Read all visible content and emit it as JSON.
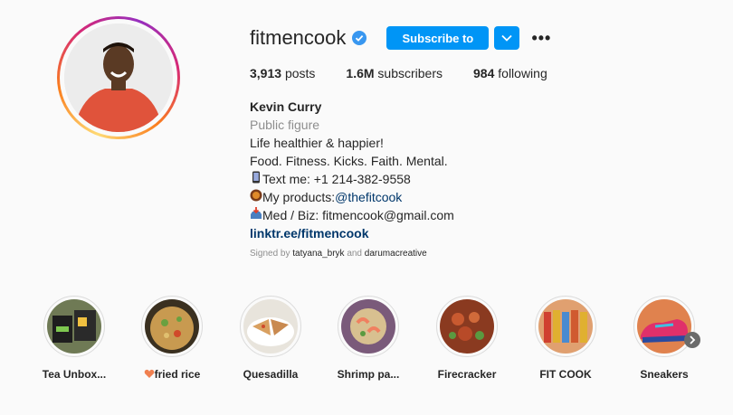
{
  "profile": {
    "username": "fitmencook",
    "subscribe_label": "Subscribe to",
    "more_label": "•••",
    "stats": [
      {
        "value": "3,913",
        "label": "posts"
      },
      {
        "value": "1.6M",
        "label": "subscribers"
      },
      {
        "value": "984",
        "label": "following"
      }
    ],
    "name": "Kevin Curry",
    "category": "Public figure",
    "bio_lines": [
      "Life healthier & happier!",
      "Food. Fitness. Kicks. Faith. Mental."
    ],
    "text_me_prefix": "Text me: +1 214-382-9558",
    "products_prefix": "My products:",
    "products_handle": "@thefitcook",
    "biz_line": "Med / Biz: fitmencook@gmail.com",
    "link": "linktr.ee/fitmencook",
    "signed_prefix": "Signed by",
    "signed_user1": "tatyana_bryk",
    "signed_and": "and",
    "signed_user2": "darumacreative"
  },
  "highlights": [
    {
      "label": "Tea Unbox...",
      "color": "#5a6b3a"
    },
    {
      "label": "fried rice",
      "color": "#b5864a"
    },
    {
      "label": "Quesadilla",
      "color": "#c9a070"
    },
    {
      "label": "Shrimp pa...",
      "color": "#8a6a8a"
    },
    {
      "label": "Firecracker",
      "color": "#a04a2a"
    },
    {
      "label": "FIT COOK",
      "color": "#d9803f"
    },
    {
      "label": "Sneakers",
      "color": "#e07a4a"
    }
  ],
  "colors": {
    "accent": "#0095f6",
    "link": "#00376b",
    "muted": "#8e8e8e"
  }
}
